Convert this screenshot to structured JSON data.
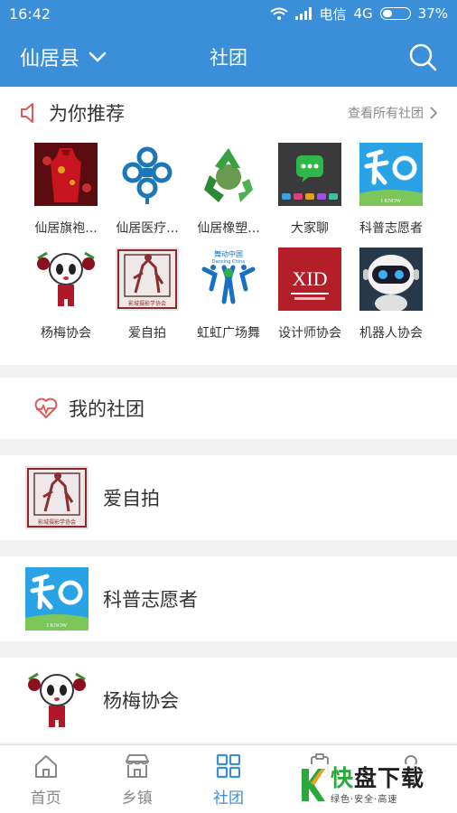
{
  "status": {
    "time": "16:42",
    "carrier": "电信",
    "network": "4G",
    "battery": "37%",
    "battery_level": 0.37
  },
  "header": {
    "location": "仙居县",
    "title": "社团"
  },
  "recommend": {
    "title": "为你推荐",
    "see_all": "查看所有社团",
    "items": [
      {
        "label": "仙居旗袍...",
        "icon": "qipao-dress-thumb"
      },
      {
        "label": "仙居医疗...",
        "icon": "medical-knot-logo"
      },
      {
        "label": "仙居橡塑...",
        "icon": "recycle-globe-logo"
      },
      {
        "label": "大家聊",
        "icon": "chat-app-logo"
      },
      {
        "label": "科普志愿者",
        "icon": "i-know-logo"
      },
      {
        "label": "杨梅协会",
        "icon": "bayberry-mascot"
      },
      {
        "label": "爱自拍",
        "icon": "photography-association-logo"
      },
      {
        "label": "虹虹广场舞",
        "icon": "dancing-china-logo"
      },
      {
        "label": "设计师协会",
        "icon": "designer-association-logo"
      },
      {
        "label": "机器人协会",
        "icon": "robot-logo"
      }
    ],
    "logo_texts": {
      "i_know": "I KNOW",
      "dancing_cn": "舞动中国",
      "dancing_en": "Dancing China",
      "xid": "XID",
      "photo_caption": "影城摄影学协会"
    }
  },
  "mine": {
    "title": "我的社团",
    "items": [
      {
        "name": "爱自拍",
        "icon": "photography-association-logo"
      },
      {
        "name": "科普志愿者",
        "icon": "i-know-logo"
      },
      {
        "name": "杨梅协会",
        "icon": "bayberry-mascot"
      }
    ]
  },
  "tabs": [
    {
      "label": "首页",
      "icon": "home-icon",
      "active": false
    },
    {
      "label": "乡镇",
      "icon": "shop-icon",
      "active": false
    },
    {
      "label": "社团",
      "icon": "grid-icon",
      "active": true
    },
    {
      "label": "",
      "icon": "clipboard-icon",
      "active": false
    },
    {
      "label": "",
      "icon": "user-icon",
      "active": false
    }
  ],
  "watermark": {
    "big_a": "快",
    "big_b": "盘下载",
    "small": "绿色·安全·高速"
  },
  "colors": {
    "primary": "#3a8fd8",
    "accent_red": "#e05a5a",
    "watermark_green": "#2aa93a"
  }
}
